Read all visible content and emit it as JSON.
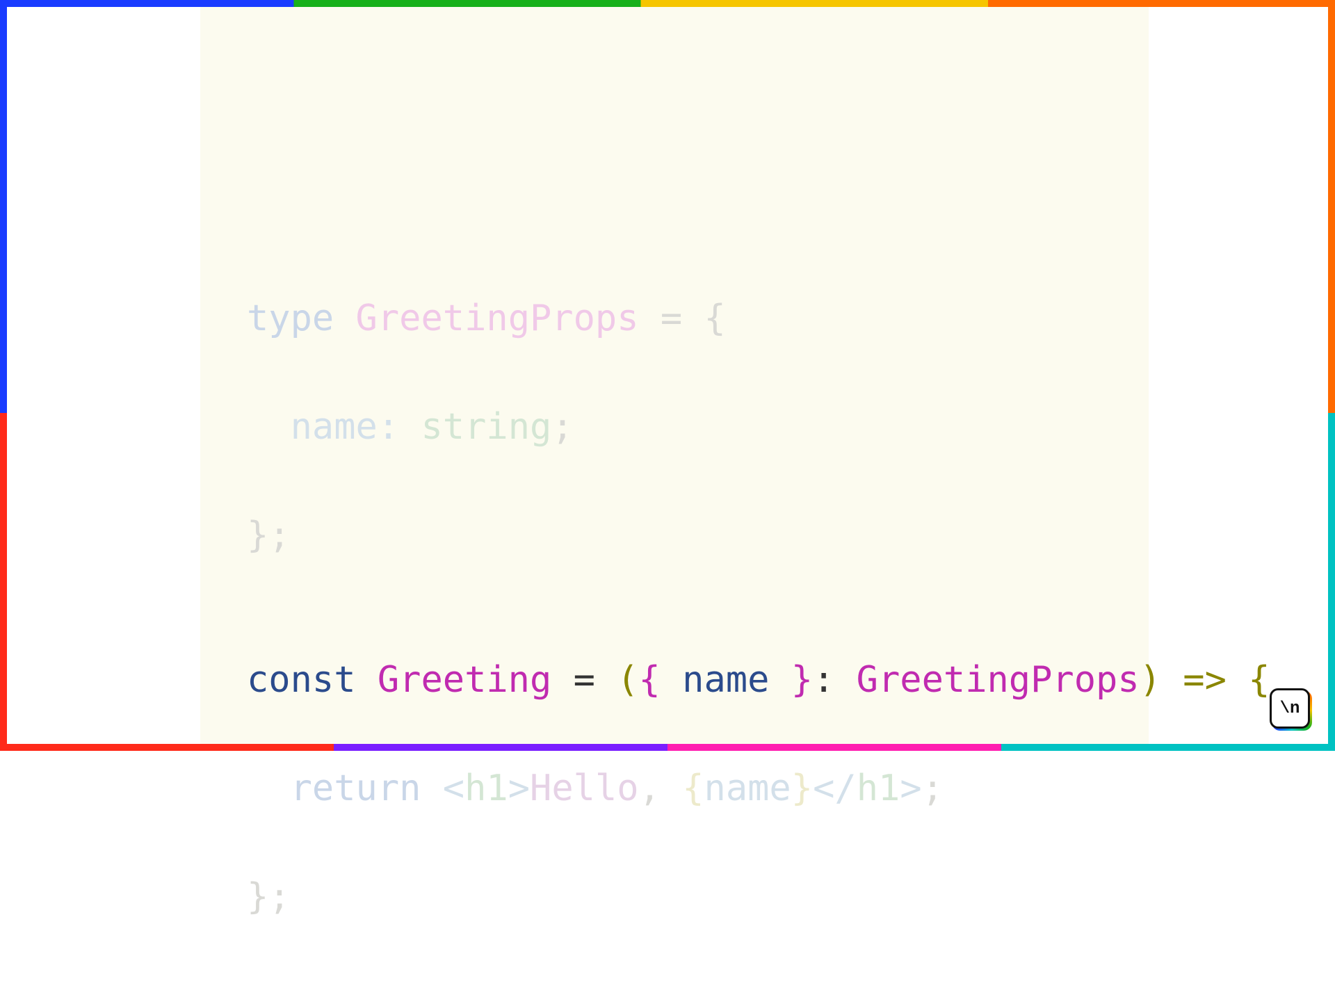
{
  "code": {
    "line1": {
      "kw": "type ",
      "name": "GreetingProps",
      "rest": " = {"
    },
    "line2": {
      "indent": "  ",
      "prop": "name",
      "colon": ":",
      "sp": " ",
      "ty": "string",
      "semi": ";"
    },
    "line3": {
      "close": "};"
    },
    "line5": {
      "kw": "const ",
      "fn": "Greeting",
      "sp1": " ",
      "eq": "=",
      "sp2": " ",
      "lpar": "(",
      "lbrc": "{ ",
      "ident": "name",
      "rbrc": " }",
      "colon": ":",
      "sp3": " ",
      "type": "GreetingProps",
      "rpar": ")",
      "sp4": " ",
      "arrow": "=>",
      "sp5": " ",
      "open": "{"
    },
    "line6": {
      "indent": "  ",
      "kw": "return ",
      "lt1": "<",
      "tag1": "h1",
      "gt1": ">",
      "txt": "Hello",
      "comma": ", ",
      "lb": "{",
      "var": "name",
      "rb": "}",
      "lt2": "</",
      "tag2": "h1",
      "gt2": ">",
      "semi": ";"
    },
    "line7": {
      "close": "};"
    }
  },
  "logo": {
    "text": "\\n"
  }
}
